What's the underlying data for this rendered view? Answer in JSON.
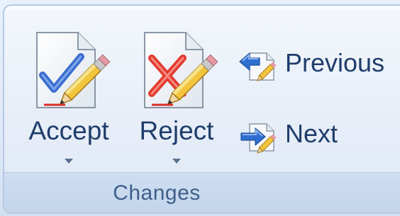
{
  "group": {
    "label": "Changes"
  },
  "buttons": {
    "accept": {
      "label": "Accept",
      "icon": "accept-document-check-icon",
      "has_dropdown": true
    },
    "reject": {
      "label": "Reject",
      "icon": "reject-document-x-icon",
      "has_dropdown": true
    },
    "previous": {
      "label": "Previous",
      "icon": "previous-change-arrow-icon"
    },
    "next": {
      "label": "Next",
      "icon": "next-change-arrow-icon"
    }
  },
  "colors": {
    "ribbon_background": "#e4ecf7",
    "group_border": "#b7c9e2",
    "footer_background": "#c9daef",
    "label_text": "#1f3d6b",
    "group_label_text": "#3f5f8c",
    "check_blue": "#3a6fcf",
    "reject_red": "#e23b2e",
    "arrow_blue": "#2f6fd1"
  }
}
